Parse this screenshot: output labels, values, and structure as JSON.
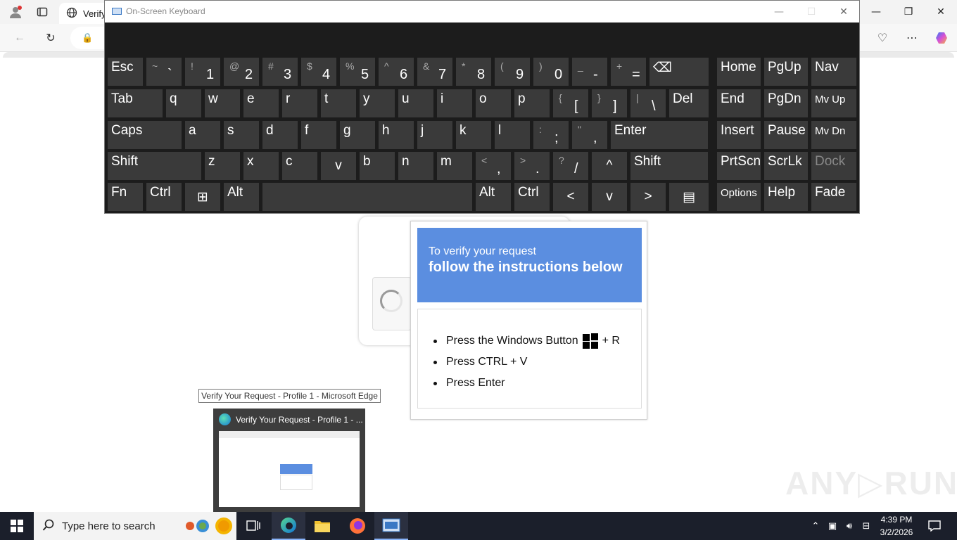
{
  "browser": {
    "tab_title": "Verify",
    "window_title": "Verify Your Request - Profile 1 - Microsoft Edge"
  },
  "osk": {
    "title": "On-Screen Keyboard",
    "rows": [
      [
        {
          "label": "Esc"
        },
        {
          "sym": "~",
          "main": "`"
        },
        {
          "sym": "!",
          "main": "1"
        },
        {
          "sym": "@",
          "main": "2"
        },
        {
          "sym": "#",
          "main": "3"
        },
        {
          "sym": "$",
          "main": "4"
        },
        {
          "sym": "%",
          "main": "5"
        },
        {
          "sym": "^",
          "main": "6"
        },
        {
          "sym": "&",
          "main": "7"
        },
        {
          "sym": "*",
          "main": "8"
        },
        {
          "sym": "(",
          "main": "9"
        },
        {
          "sym": ")",
          "main": "0"
        },
        {
          "sym": "_",
          "main": "-"
        },
        {
          "sym": "+",
          "main": "="
        },
        {
          "label": "⌫"
        },
        {
          "label": "Home"
        },
        {
          "label": "PgUp"
        },
        {
          "label": "Nav"
        }
      ],
      [
        {
          "label": "Tab"
        },
        {
          "label": "q"
        },
        {
          "label": "w"
        },
        {
          "label": "e"
        },
        {
          "label": "r"
        },
        {
          "label": "t"
        },
        {
          "label": "y"
        },
        {
          "label": "u"
        },
        {
          "label": "i"
        },
        {
          "label": "o"
        },
        {
          "label": "p"
        },
        {
          "sym": "{",
          "main": "["
        },
        {
          "sym": "}",
          "main": "]"
        },
        {
          "sym": "|",
          "main": "\\"
        },
        {
          "label": "Del"
        },
        {
          "label": "End"
        },
        {
          "label": "PgDn"
        },
        {
          "label": "Mv Up"
        }
      ],
      [
        {
          "label": "Caps"
        },
        {
          "label": "a"
        },
        {
          "label": "s"
        },
        {
          "label": "d"
        },
        {
          "label": "f"
        },
        {
          "label": "g"
        },
        {
          "label": "h"
        },
        {
          "label": "j"
        },
        {
          "label": "k"
        },
        {
          "label": "l"
        },
        {
          "sym": ":",
          "main": ";"
        },
        {
          "sym": "\"",
          "main": ","
        },
        {
          "label": "Enter"
        },
        {
          "label": "Insert"
        },
        {
          "label": "Pause"
        },
        {
          "label": "Mv Dn"
        }
      ],
      [
        {
          "label": "Shift"
        },
        {
          "label": "z"
        },
        {
          "label": "x"
        },
        {
          "label": "c"
        },
        {
          "label": "v"
        },
        {
          "label": "b"
        },
        {
          "label": "n"
        },
        {
          "label": "m"
        },
        {
          "sym": "<",
          "main": ","
        },
        {
          "sym": ">",
          "main": "."
        },
        {
          "sym": "?",
          "main": "/"
        },
        {
          "label": "^"
        },
        {
          "label": "Shift"
        },
        {
          "label": "PrtScn"
        },
        {
          "label": "ScrLk"
        },
        {
          "label": "Dock"
        }
      ],
      [
        {
          "label": "Fn"
        },
        {
          "label": "Ctrl"
        },
        {
          "label": "⊞"
        },
        {
          "label": "Alt"
        },
        {
          "label": ""
        },
        {
          "label": "Alt"
        },
        {
          "label": "Ctrl"
        },
        {
          "label": "<"
        },
        {
          "label": "v"
        },
        {
          "label": ">"
        },
        {
          "label": "▤"
        },
        {
          "label": "Options"
        },
        {
          "label": "Help"
        },
        {
          "label": "Fade"
        }
      ]
    ]
  },
  "verify": {
    "head_line1": "To verify your request",
    "head_line2": "follow the instructions below",
    "step1_before": "Press the Windows Button",
    "step1_after": "+ R",
    "step2": "Press CTRL + V",
    "step3": "Press Enter"
  },
  "taskbar": {
    "tooltip": "Verify Your Request - Profile 1 - Microsoft Edge",
    "thumb_title": "Verify Your Request - Profile 1 - ...",
    "search_placeholder": "Type here to search",
    "time": "4:39 PM",
    "date": "3/2/2026"
  },
  "watermark": "ANY▷RUN"
}
